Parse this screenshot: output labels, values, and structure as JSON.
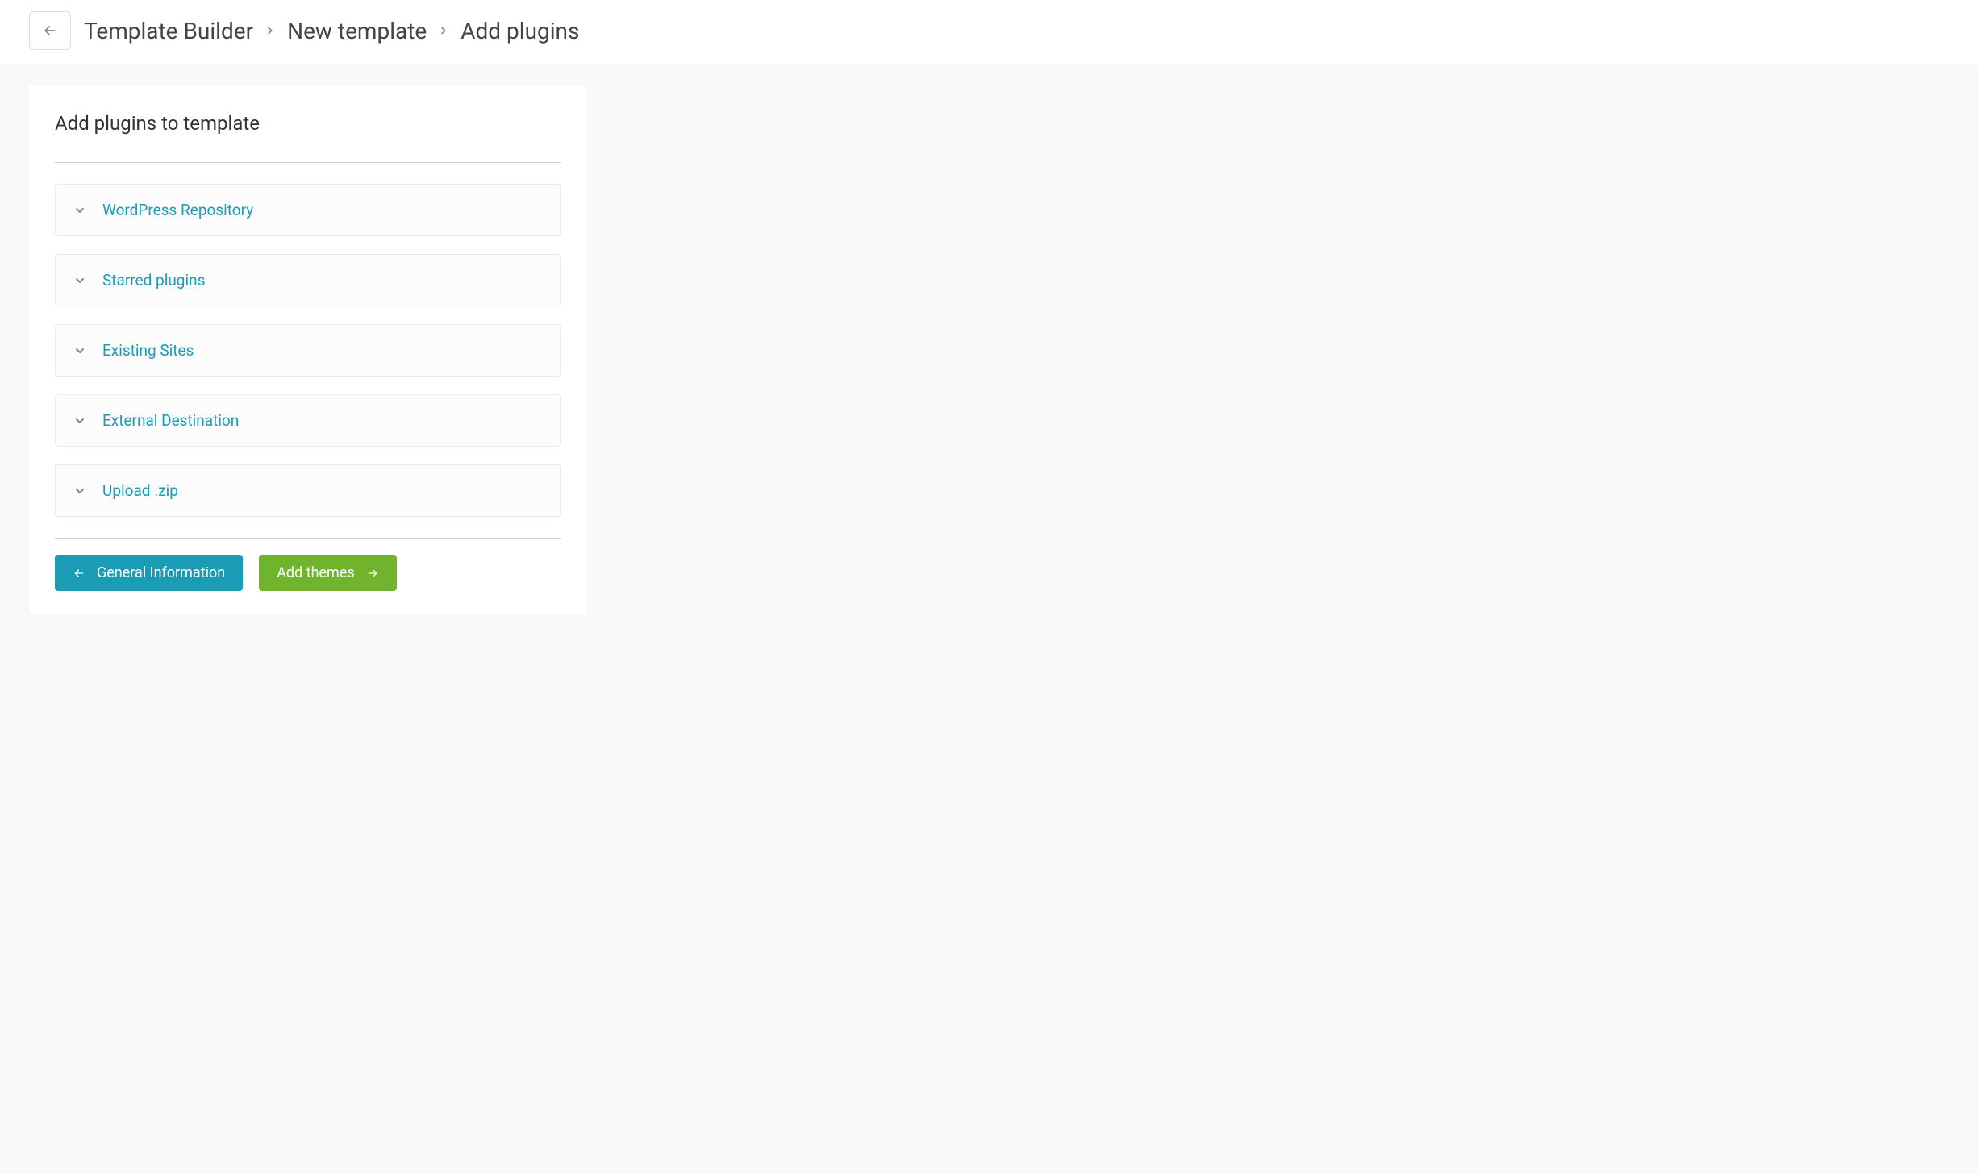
{
  "breadcrumb": {
    "items": [
      "Template Builder",
      "New template",
      "Add plugins"
    ]
  },
  "card": {
    "title": "Add plugins to template"
  },
  "accordion": {
    "items": [
      {
        "label": "WordPress Repository"
      },
      {
        "label": "Starred plugins"
      },
      {
        "label": "Existing Sites"
      },
      {
        "label": "External Destination"
      },
      {
        "label": "Upload .zip"
      }
    ]
  },
  "buttons": {
    "back": "General Information",
    "next": "Add themes"
  }
}
